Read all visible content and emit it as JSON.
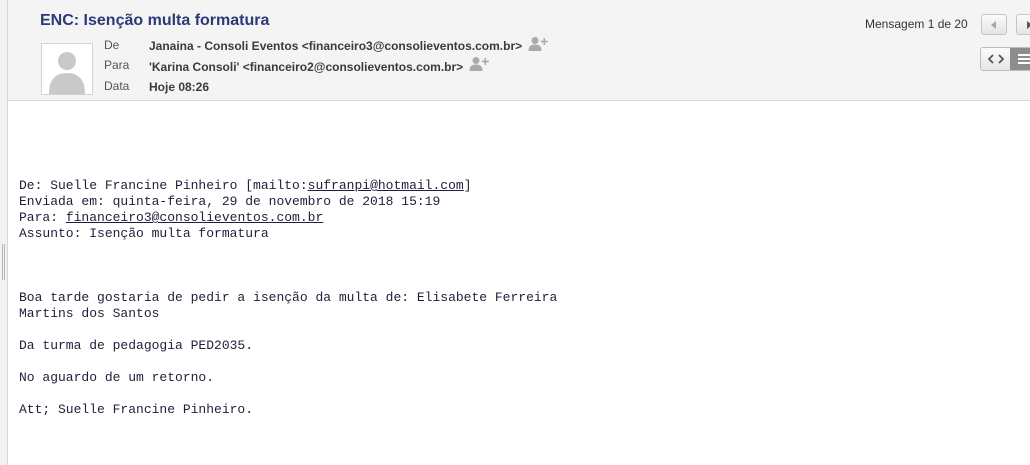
{
  "message": {
    "subject": "ENC: Isenção multa formatura",
    "from_label": "De",
    "from_value": "Janaina - Consoli Eventos <financeiro3@consolieventos.com.br>",
    "to_label": "Para",
    "to_value": "'Karina Consoli' <financeiro2@consolieventos.com.br>",
    "date_label": "Data",
    "date_value": "Hoje 08:26"
  },
  "navigation": {
    "counter": "Mensagem 1 de 20"
  },
  "icons": {
    "avatar": "avatar-placeholder-icon",
    "add_contact": "add-contact-icon",
    "prev": "chevron-left-icon",
    "next": "chevron-right-icon",
    "source_view": "code-icon",
    "text_view": "menu-lines-icon"
  },
  "body": {
    "fwd_from_prefix": "De: Suelle Francine Pinheiro [mailto:",
    "fwd_from_email": "sufranpi@hotmail.com",
    "fwd_from_suffix": "]",
    "fwd_sent": "Enviada em: quinta-feira, 29 de novembro de 2018 15:19",
    "fwd_to_prefix": "Para: ",
    "fwd_to_email": "financeiro3@consolieventos.com.br",
    "fwd_subject": "Assunto: Isenção multa formatura",
    "line1": "Boa tarde gostaria de pedir a isenção da multa de: Elisabete Ferreira",
    "line2": "Martins dos Santos",
    "line3": "Da turma de pedagogia PED2035.",
    "line4": "No aguardo de um retorno.",
    "line5": "Att; Suelle Francine Pinheiro."
  },
  "colors": {
    "subject": "#2c3a78",
    "header_bg": "#f4f4f4",
    "active_toggle": "#8d8d8d"
  }
}
